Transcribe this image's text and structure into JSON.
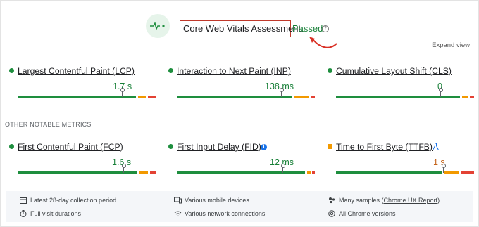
{
  "header": {
    "assessment_title": "Core Web Vitals Assessment:",
    "assessment_status": "Passed",
    "expand_view": "Expand view"
  },
  "core_metrics": [
    {
      "name": "Largest Contentful Paint (LCP)",
      "value": "1.7 s",
      "status": "good"
    },
    {
      "name": "Interaction to Next Paint (INP)",
      "value": "138 ms",
      "status": "good"
    },
    {
      "name": "Cumulative Layout Shift (CLS)",
      "value": "0",
      "status": "good"
    }
  ],
  "other_section_label": "OTHER NOTABLE METRICS",
  "other_metrics": [
    {
      "name": "First Contentful Paint (FCP)",
      "value": "1.6 s",
      "status": "good"
    },
    {
      "name": "First Input Delay (FID)",
      "value": "12 ms",
      "status": "good"
    },
    {
      "name": "Time to First Byte (TTFB)",
      "value": "1 s",
      "status": "needs-improvement"
    }
  ],
  "footer": {
    "collection_period": "Latest 28-day collection period",
    "devices": "Various mobile devices",
    "samples_prefix": "Many samples (",
    "samples_link": "Chrome UX Report",
    "samples_suffix": ")",
    "visit_durations": "Full visit durations",
    "network": "Various network connections",
    "chrome_versions": "All Chrome versions"
  },
  "colors": {
    "good": "#1e8e3e",
    "needs_improvement": "#f29900",
    "poor": "#e34234",
    "passed_text": "#188038"
  }
}
